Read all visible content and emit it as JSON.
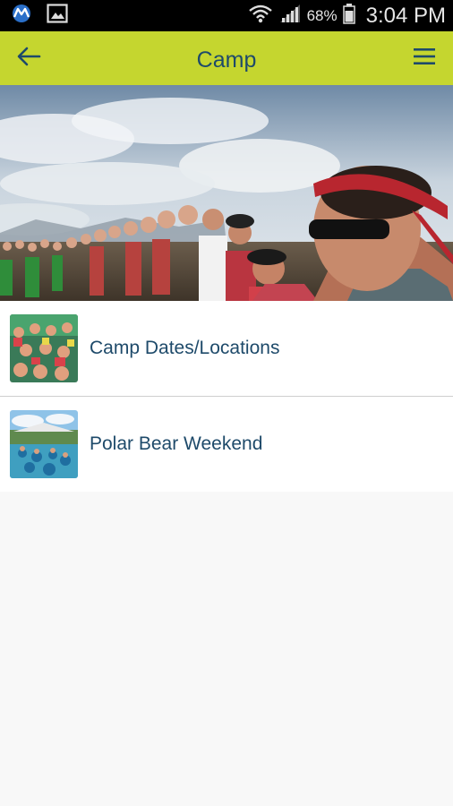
{
  "status_bar": {
    "battery_percent": "68%",
    "time": "3:04 PM",
    "icons": [
      "app-notification-icon",
      "gallery-icon",
      "wifi-icon",
      "signal-icon",
      "battery-icon"
    ]
  },
  "app_bar": {
    "title": "Camp",
    "background": "#c5d62f",
    "text_color": "#1e4a6a",
    "back_icon": "arrow-left-icon",
    "menu_icon": "hamburger-menu-icon"
  },
  "hero": {
    "image": "camp-crowd-photo"
  },
  "list": {
    "items": [
      {
        "label": "Camp Dates/Locations",
        "thumbnail": "camp-crowd-thumbnail"
      },
      {
        "label": "Polar Bear Weekend",
        "thumbnail": "polar-bear-pool-thumbnail"
      }
    ]
  }
}
